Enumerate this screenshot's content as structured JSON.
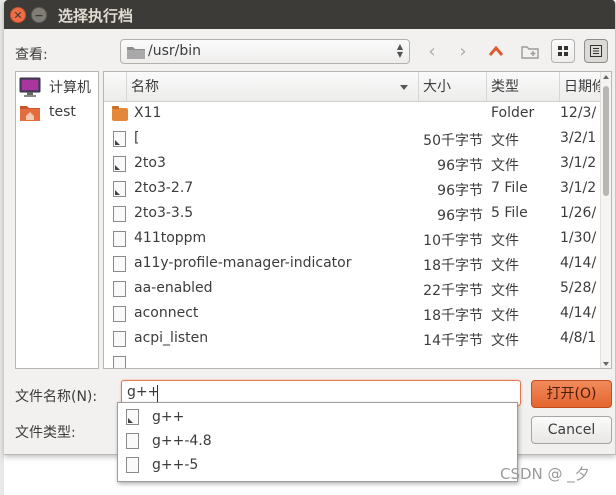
{
  "dialog": {
    "title": "选择执行档"
  },
  "toolbar": {
    "look_in_label": "查看:",
    "path": "/usr/bin"
  },
  "sidebar": {
    "items": [
      {
        "label": "计算机"
      },
      {
        "label": "test"
      }
    ]
  },
  "columns": {
    "name": "名称",
    "size": "大小",
    "type": "类型",
    "date": "日期修"
  },
  "files": [
    {
      "name": "X11",
      "size": "",
      "type": "Folder",
      "date": "12/3/",
      "kind": "folder"
    },
    {
      "name": "[",
      "size": "50千字节",
      "type": "文件",
      "date": "3/2/1",
      "kind": "exe"
    },
    {
      "name": "2to3",
      "size": "96字节",
      "type": "文件",
      "date": "3/1/2",
      "kind": "exe"
    },
    {
      "name": "2to3-2.7",
      "size": "96字节",
      "type": "7 File",
      "date": "3/1/2",
      "kind": "exe"
    },
    {
      "name": "2to3-3.5",
      "size": "96字节",
      "type": "5 File",
      "date": "1/26/",
      "kind": "file"
    },
    {
      "name": "411toppm",
      "size": "10千字节",
      "type": "文件",
      "date": "1/30/",
      "kind": "file"
    },
    {
      "name": "a11y-profile-manager-indicator",
      "size": "18千字节",
      "type": "文件",
      "date": "4/14/",
      "kind": "file"
    },
    {
      "name": "aa-enabled",
      "size": "22千字节",
      "type": "文件",
      "date": "5/28/",
      "kind": "file"
    },
    {
      "name": "aconnect",
      "size": "18千字节",
      "type": "文件",
      "date": "4/14/",
      "kind": "file"
    },
    {
      "name": "acpi_listen",
      "size": "14千字节",
      "type": "文件",
      "date": "4/8/1",
      "kind": "file"
    },
    {
      "name": "",
      "size": "",
      "type": "",
      "date": "",
      "kind": "file"
    }
  ],
  "filename": {
    "label": "文件名称(N):",
    "value": "g++"
  },
  "filetype": {
    "label": "文件类型:"
  },
  "buttons": {
    "open": "打开(O)",
    "cancel": "Cancel"
  },
  "completions": [
    "g++",
    "g++-4.8",
    "g++-5"
  ],
  "watermark": "CSDN @ _夕"
}
